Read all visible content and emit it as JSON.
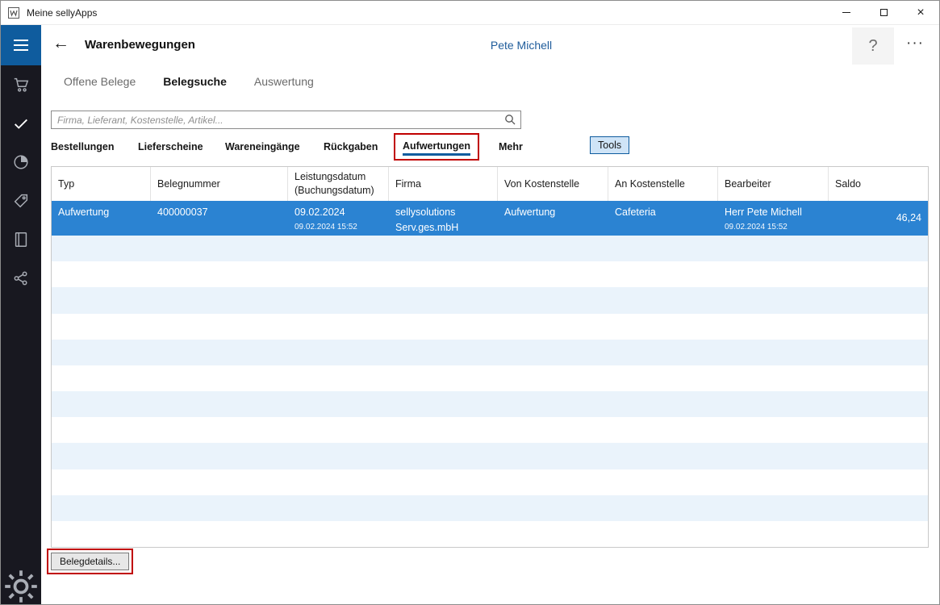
{
  "titlebar": {
    "title": "Meine sellyApps"
  },
  "icons": {
    "back": "←",
    "help": "?",
    "more": "···",
    "close": "×"
  },
  "header": {
    "title": "Warenbewegungen",
    "user": "Pete Michell"
  },
  "tabs": [
    {
      "label": "Offene Belege",
      "active": false
    },
    {
      "label": "Belegsuche",
      "active": true
    },
    {
      "label": "Auswertung",
      "active": false
    }
  ],
  "search": {
    "placeholder": "Firma, Lieferant, Kostenstelle, Artikel...",
    "value": ""
  },
  "filters": {
    "items": [
      "Bestellungen",
      "Lieferscheine",
      "Wareneingänge",
      "Rückgaben",
      "Aufwertungen",
      "Mehr"
    ],
    "selected": "Aufwertungen",
    "tools_label": "Tools"
  },
  "table": {
    "columns": [
      "Typ",
      "Belegnummer",
      "Leistungsdatum\n(Buchungsdatum)",
      "Firma",
      "Von Kostenstelle",
      "An Kostenstelle",
      "Bearbeiter",
      "Saldo"
    ],
    "row": {
      "typ": "Aufwertung",
      "belegnummer": "400000037",
      "leistungsdatum": "09.02.2024",
      "buchungsdatum": "09.02.2024 15:52",
      "firma": "sellysolutions\nServ.ges.mbH",
      "von_kostenstelle": "Aufwertung",
      "an_kostenstelle": "Cafeteria",
      "bearbeiter": "Herr Pete Michell",
      "bearbeiter_datum": "09.02.2024 15:52",
      "saldo": "46,24"
    }
  },
  "footer": {
    "details_button": "Belegdetails..."
  },
  "colors": {
    "accent": "#0f5c9e",
    "selection": "#2b83d2",
    "stripe": "#eaf3fb",
    "annotation": "#c00000",
    "sidebar-bg": "#181820",
    "user-color": "#1f5c9b",
    "tools-bg": "#cfe4f7"
  }
}
